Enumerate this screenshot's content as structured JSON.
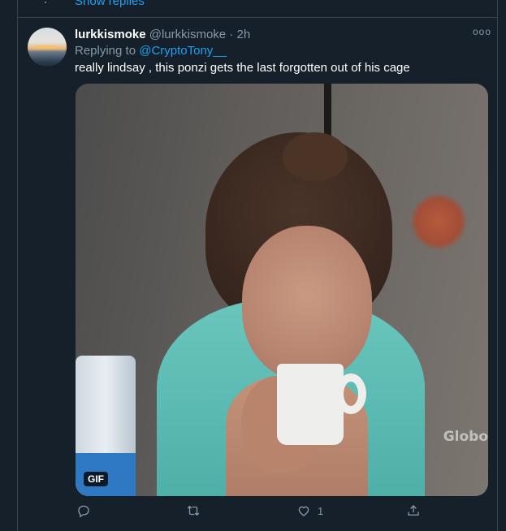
{
  "thread": {
    "show_replies": "Show replies"
  },
  "tweet": {
    "display_name": "lurkkismoke",
    "handle": "@lurkkismoke",
    "separator": "·",
    "time": "2h",
    "replying_label": "Replying to",
    "replying_to": "@CryptoTony__",
    "text": "really lindsay , this ponzi gets the last forgotten out of his cage",
    "more_icon": "ooo",
    "media": {
      "type": "gif",
      "badge": "GIF",
      "watermark": "Globo"
    },
    "actions": {
      "reply": {
        "icon": "reply-icon",
        "count": ""
      },
      "retweet": {
        "icon": "retweet-icon",
        "count": ""
      },
      "like": {
        "icon": "heart-icon",
        "count": "1"
      },
      "share": {
        "icon": "share-icon",
        "count": ""
      }
    }
  },
  "colors": {
    "background": "#15202b",
    "border": "#38444d",
    "accent": "#1da1f2",
    "muted": "#8899a6",
    "text": "#ffffff"
  }
}
